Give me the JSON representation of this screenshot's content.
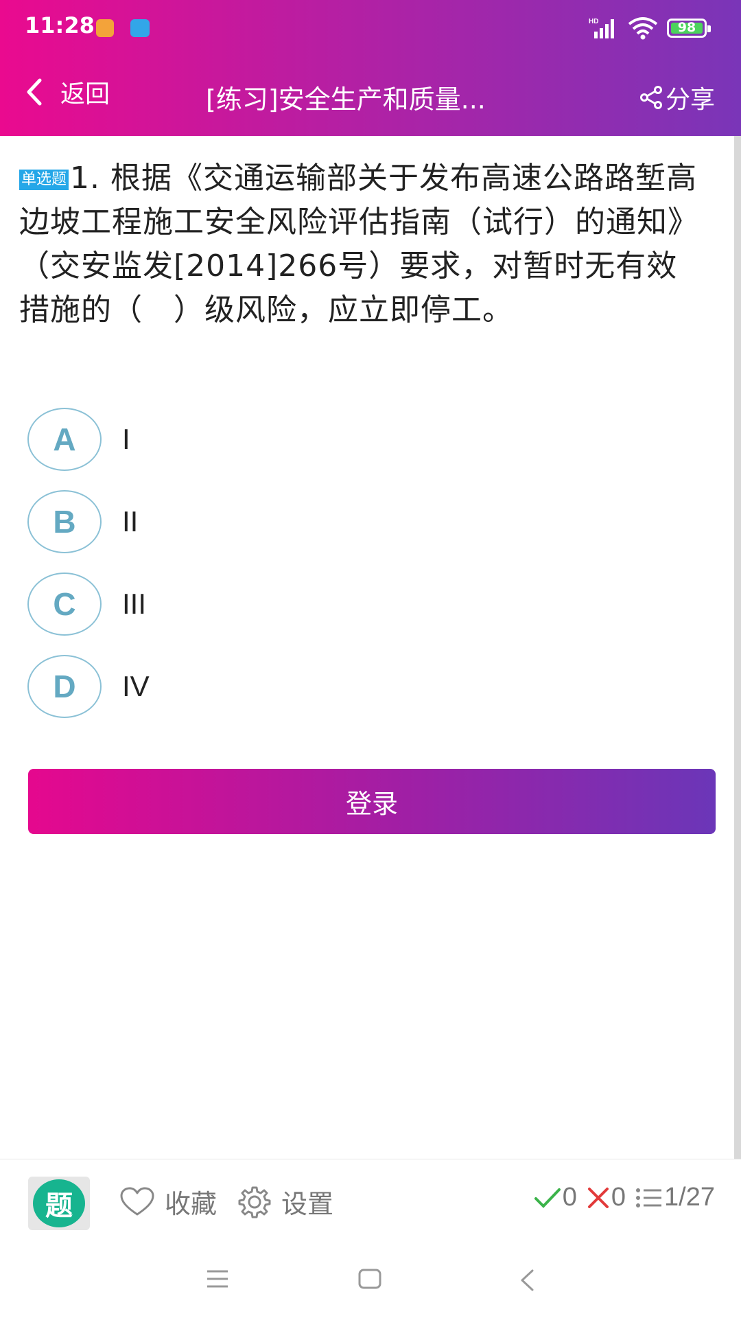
{
  "status_bar": {
    "time": "11:28",
    "battery": "98",
    "network": "HD"
  },
  "header": {
    "back_label": "返回",
    "title": "[练习]安全生产和质量...",
    "share_label": "分享"
  },
  "question": {
    "type_badge": "单选题",
    "text": "1. 根据《交通运输部关于发布高速公路路堑高边坡工程施工安全风险评估指南（试行）的通知》（交安监发[2014]266号）要求，对暂时无有效措施的（　）级风险，应立即停工。"
  },
  "options": [
    {
      "letter": "A",
      "text": "I"
    },
    {
      "letter": "B",
      "text": "II"
    },
    {
      "letter": "C",
      "text": "III"
    },
    {
      "letter": "D",
      "text": "IV"
    }
  ],
  "login_button": "登录",
  "bottom_bar": {
    "logo_char": "题",
    "favorite_label": "收藏",
    "settings_label": "设置",
    "correct_count": "0",
    "wrong_count": "0",
    "progress": "1/27"
  },
  "colors": {
    "header_gradient_start": "#ea0a8f",
    "header_gradient_end": "#7a35b8",
    "option_circle": "#8bc1d6",
    "badge": "#25a7e8",
    "correct": "#3bb34a",
    "wrong": "#e23a3a",
    "logo": "#17b48f"
  },
  "icons": {
    "back": "chevron-left-icon",
    "share": "share-icon",
    "favorite": "heart-icon",
    "settings": "gear-icon",
    "correct": "check-icon",
    "wrong": "cross-icon",
    "progress": "list-icon"
  }
}
